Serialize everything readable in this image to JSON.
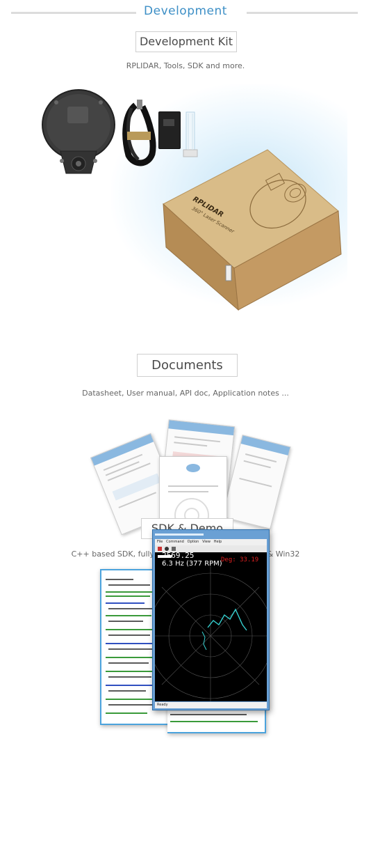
{
  "header": {
    "title": "Development"
  },
  "sections": {
    "devkit": {
      "title": "Development Kit",
      "subtitle": "RPLIDAR, Tools, SDK and more."
    },
    "documents": {
      "title": "Documents",
      "subtitle": "Datasheet, User manual, API doc, Application notes ..."
    },
    "sdk": {
      "title": "SDK & Demo",
      "subtitle": "C++ based SDK, fully open source, supports Linux & Win32"
    }
  },
  "box": {
    "brand": "RPLIDAR",
    "tagline": "360° Laser Scanner"
  },
  "radar": {
    "menu": [
      "File",
      "Command",
      "Option",
      "View",
      "Help"
    ],
    "distance": "2569.25",
    "angle": "Deg: 33.19",
    "rate": "6.3 Hz (377 RPM)",
    "status": "Ready"
  },
  "colors": {
    "accent": "#3d8fc6",
    "rule": "#dcdcdc",
    "box_cardboard": "#c9a874",
    "window_frame": "#4ba3dd"
  }
}
